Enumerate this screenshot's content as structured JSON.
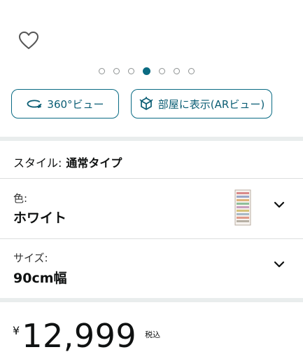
{
  "favorite": {
    "icon": "heart-outline-icon"
  },
  "gallery": {
    "dot_count": 7,
    "active_index": 3
  },
  "view_buttons": {
    "view360_label": "360°ビュー",
    "view360_icon": "rotate-360-icon",
    "ar_label": "部屋に表示(ARビュー)",
    "ar_icon": "ar-cube-icon"
  },
  "style": {
    "label": "スタイル:",
    "value": "通常タイプ"
  },
  "color": {
    "label": "色:",
    "value": "ホワイト",
    "icon": "chevron-down-icon"
  },
  "size": {
    "label": "サイズ:",
    "value": "90cm幅",
    "icon": "chevron-down-icon"
  },
  "price": {
    "currency": "¥",
    "amount": "12,999",
    "tax_note": "税込"
  },
  "colors": {
    "accent": "#0a6b84",
    "active_dot": "#0b6b82",
    "divider": "#e9eded"
  }
}
